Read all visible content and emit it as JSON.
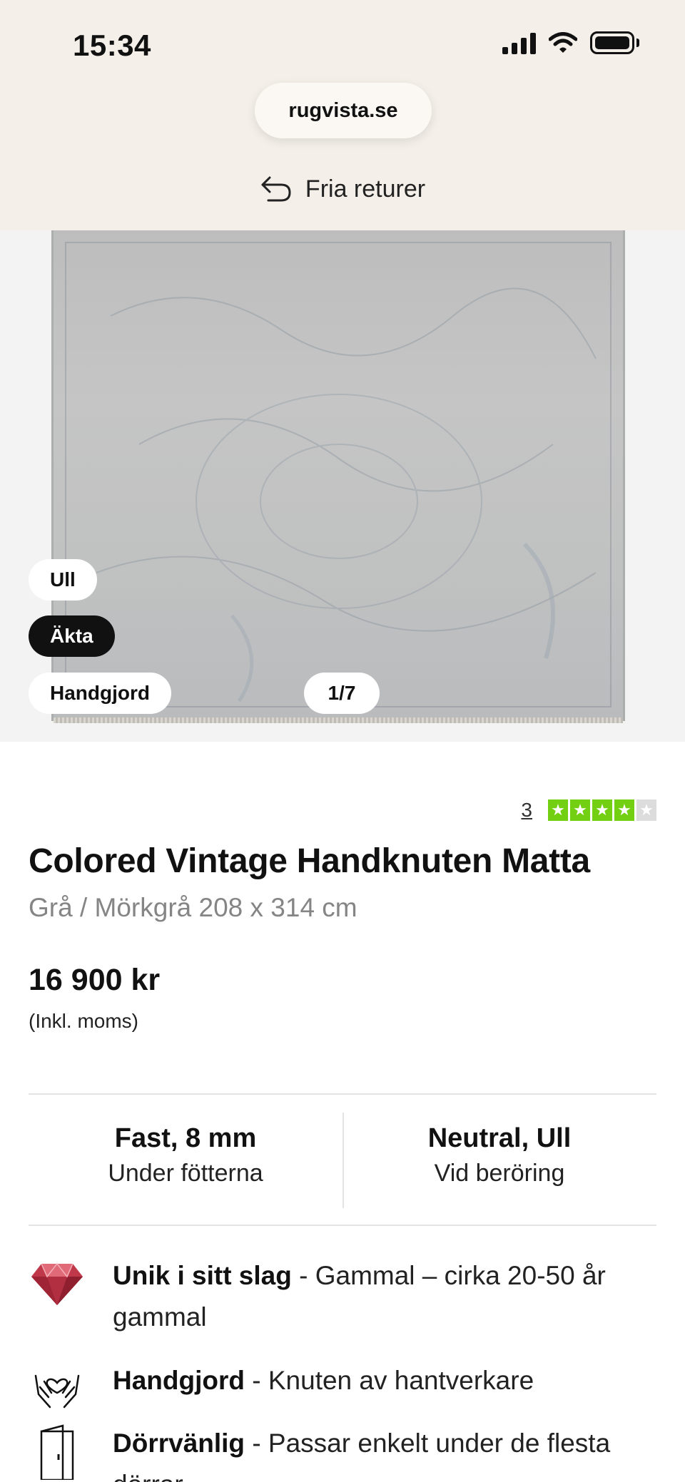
{
  "status_bar": {
    "time": "15:34"
  },
  "browser": {
    "url": "rugvista.se"
  },
  "banner": {
    "text": "Fria returer",
    "icon": "return-arrow-icon"
  },
  "gallery": {
    "tags": [
      "Ull",
      "Äkta",
      "Handgjord"
    ],
    "counter": "1/7"
  },
  "rating": {
    "count": "3",
    "stars": 4,
    "max": 5,
    "color": "#73cf11"
  },
  "product": {
    "title": "Colored Vintage Handknuten Matta",
    "subtitle": "Grå / Mörkgrå 208 x 314 cm",
    "price": "16 900 kr",
    "price_note": "(Inkl. moms)"
  },
  "specs": [
    {
      "title": "Fast, 8 mm",
      "subtitle": "Under fötterna"
    },
    {
      "title": "Neutral, Ull",
      "subtitle": "Vid beröring"
    }
  ],
  "features": [
    {
      "icon": "gem-icon",
      "bold": "Unik i sitt slag",
      "text": " - Gammal – cirka 20-50 år gammal"
    },
    {
      "icon": "hands-heart-icon",
      "bold": "Handgjord",
      "text": " - Knuten av hantverkare"
    },
    {
      "icon": "door-icon",
      "bold": "Dörrvänlig",
      "text": " - Passar enkelt under de flesta dörrar"
    }
  ]
}
